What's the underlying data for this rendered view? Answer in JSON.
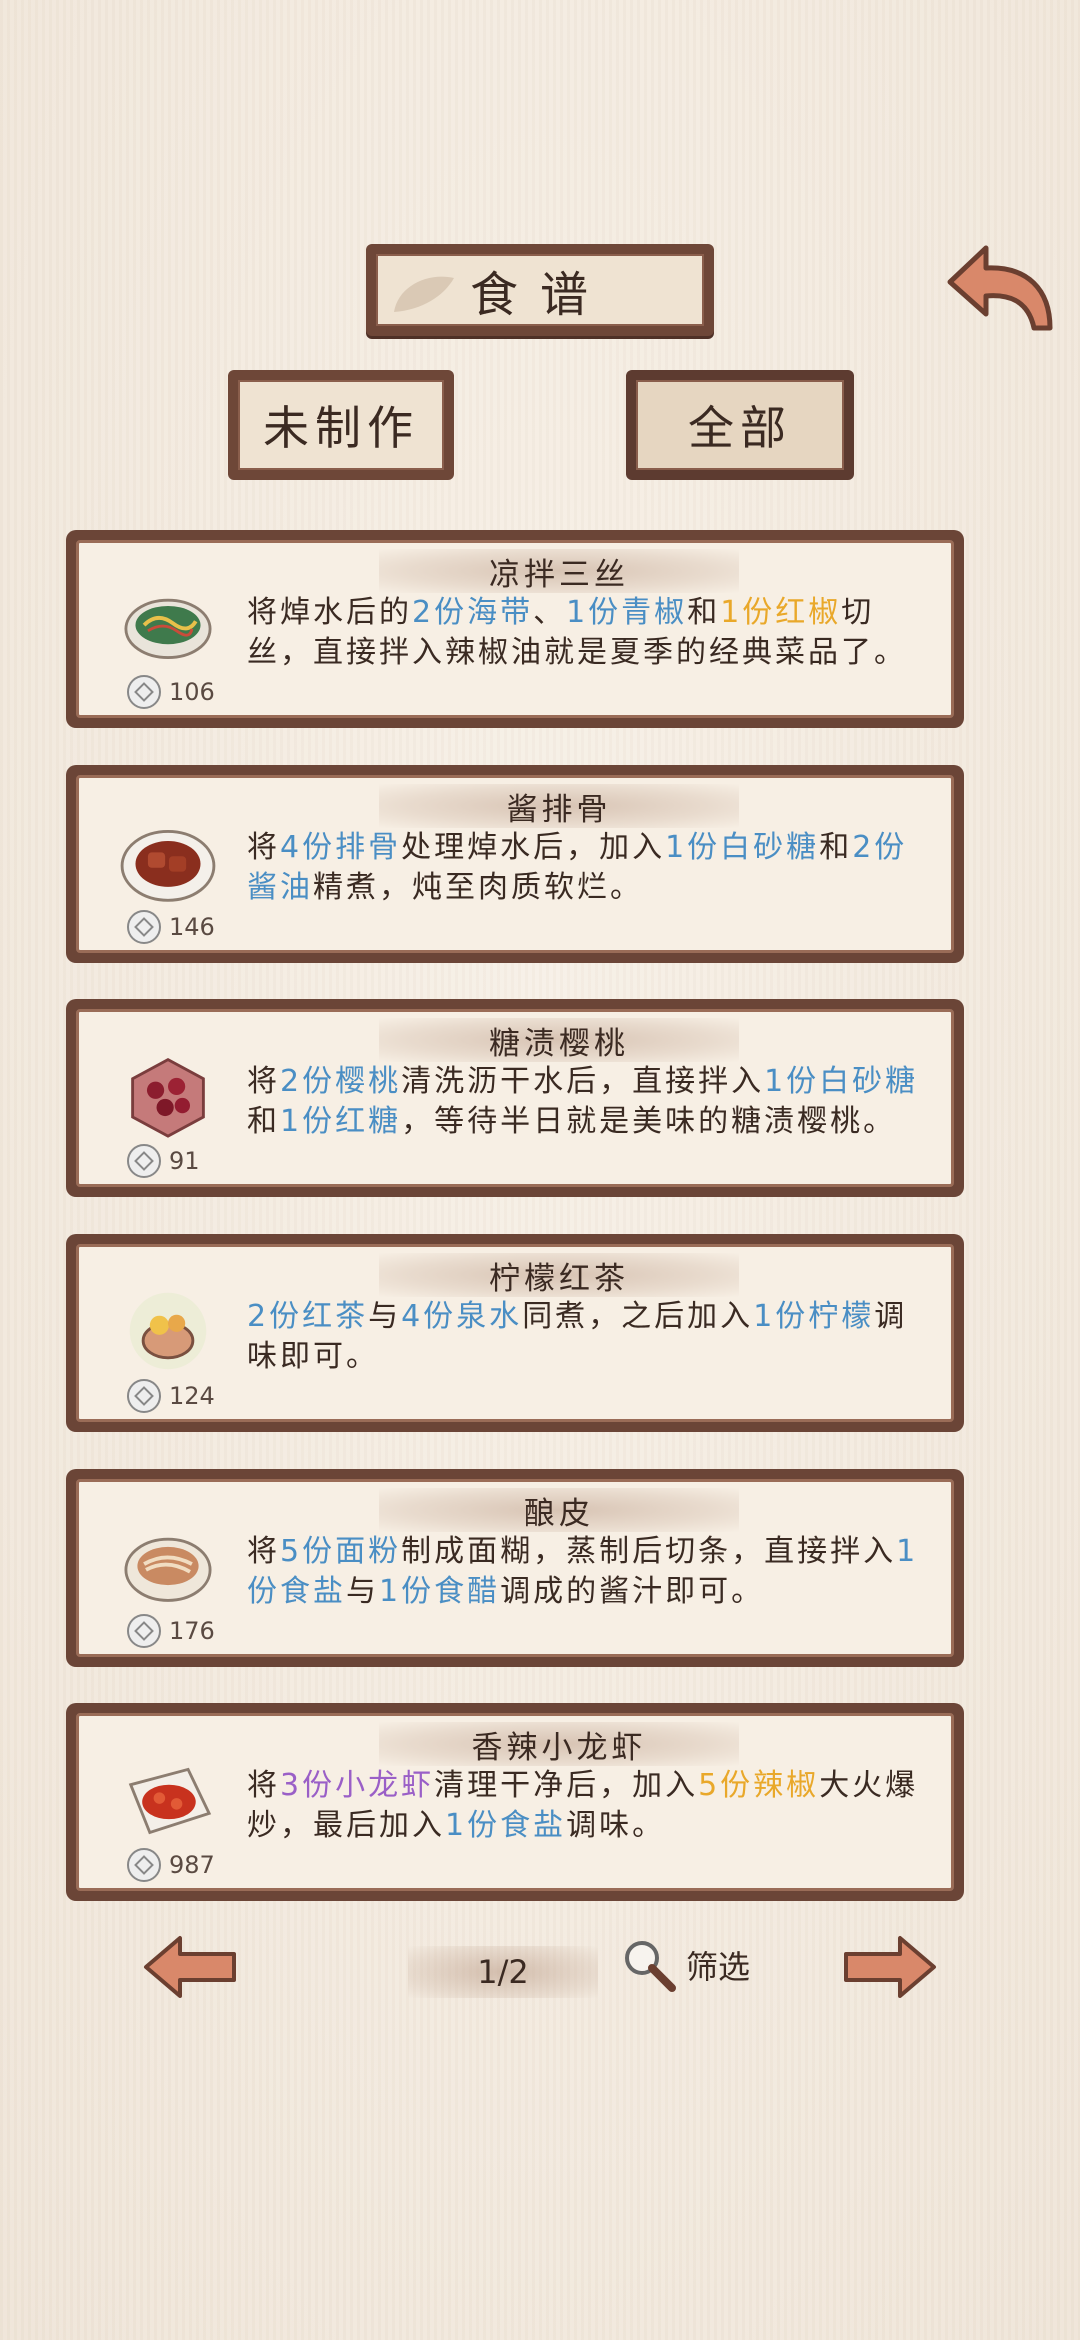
{
  "header": {
    "title": "食谱",
    "back_icon": "curved-back-arrow-icon"
  },
  "tabs": [
    {
      "label": "未制作",
      "selected": false
    },
    {
      "label": "全部",
      "selected": true
    }
  ],
  "recipes": [
    {
      "name": "凉拌三丝",
      "price": "106",
      "dish_icon": "seaweed-salad-icon",
      "desc": [
        {
          "t": "将焯水后的"
        },
        {
          "t": "2份海带",
          "c": "blue"
        },
        {
          "t": "、"
        },
        {
          "t": "1份青椒",
          "c": "blue"
        },
        {
          "t": "和"
        },
        {
          "t": "1份红椒",
          "c": "orange"
        },
        {
          "t": "切丝，直接拌入辣椒油就是夏季的经典菜品了。"
        }
      ]
    },
    {
      "name": "酱排骨",
      "price": "146",
      "dish_icon": "braised-ribs-icon",
      "desc": [
        {
          "t": "将"
        },
        {
          "t": "4份排骨",
          "c": "blue"
        },
        {
          "t": "处理焯水后，加入"
        },
        {
          "t": "1份白砂糖",
          "c": "blue"
        },
        {
          "t": "和"
        },
        {
          "t": "2份酱油",
          "c": "blue"
        },
        {
          "t": "精煮，炖至肉质软烂。"
        }
      ]
    },
    {
      "name": "糖渍樱桃",
      "price": "91",
      "dish_icon": "candied-cherries-icon",
      "desc": [
        {
          "t": "将"
        },
        {
          "t": "2份樱桃",
          "c": "blue"
        },
        {
          "t": "清洗沥干水后，直接拌入"
        },
        {
          "t": "1份白砂糖",
          "c": "blue"
        },
        {
          "t": "和"
        },
        {
          "t": "1份红糖",
          "c": "blue"
        },
        {
          "t": "，等待半日就是美味的糖渍樱桃。"
        }
      ]
    },
    {
      "name": "柠檬红茶",
      "price": "124",
      "dish_icon": "lemon-tea-icon",
      "desc": [
        {
          "t": "2份红茶",
          "c": "blue"
        },
        {
          "t": "与"
        },
        {
          "t": "4份泉水",
          "c": "blue"
        },
        {
          "t": "同煮，之后加入"
        },
        {
          "t": "1份柠檬",
          "c": "blue"
        },
        {
          "t": "调味即可。"
        }
      ]
    },
    {
      "name": "酿皮",
      "price": "176",
      "dish_icon": "liangpi-noodles-icon",
      "desc": [
        {
          "t": "将"
        },
        {
          "t": "5份面粉",
          "c": "blue"
        },
        {
          "t": "制成面糊，蒸制后切条，直接拌入"
        },
        {
          "t": "1份食盐",
          "c": "blue"
        },
        {
          "t": "与"
        },
        {
          "t": "1份食醋",
          "c": "blue"
        },
        {
          "t": "调成的酱汁即可。"
        }
      ]
    },
    {
      "name": "香辣小龙虾",
      "price": "987",
      "dish_icon": "spicy-crayfish-icon",
      "desc": [
        {
          "t": "将"
        },
        {
          "t": "3份小龙虾",
          "c": "purple"
        },
        {
          "t": "清理干净后，加入"
        },
        {
          "t": "5份辣椒",
          "c": "orange"
        },
        {
          "t": "大火爆炒，最后加入"
        },
        {
          "t": "1份食盐",
          "c": "blue"
        },
        {
          "t": "调味。"
        }
      ]
    }
  ],
  "pagination": {
    "page": "1/2",
    "filter_label": "筛选",
    "prev_icon": "left-arrow-icon",
    "next_icon": "right-arrow-icon",
    "filter_icon": "magnifier-icon"
  },
  "colors": {
    "wood": "#6b4537",
    "paper": "#f7efe4",
    "blue": "#4a8ec4",
    "orange": "#e9a82a",
    "purple": "#9a5fc7"
  }
}
